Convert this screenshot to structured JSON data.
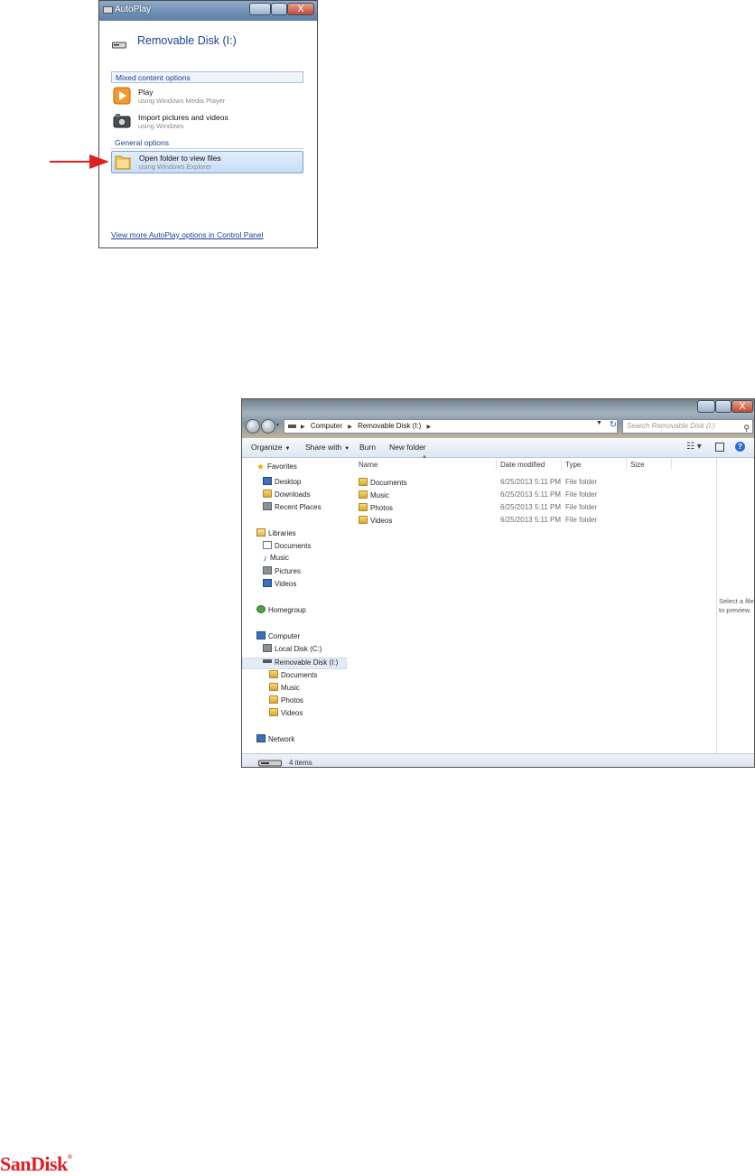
{
  "autoplay": {
    "window_title": "AutoPlay",
    "drive_title": "Removable Disk (I:)",
    "section_mixed": "Mixed content options",
    "section_general": "General options",
    "options": [
      {
        "main": "Play",
        "sub": "using Windows Media Player"
      },
      {
        "main": "Import pictures and videos",
        "sub": "using Windows"
      },
      {
        "main": "Open folder to view files",
        "sub": "using Windows Explorer"
      }
    ],
    "more_link": "View more AutoPlay options in Control Panel",
    "close_glyph": "X"
  },
  "explorer": {
    "breadcrumbs": [
      "Computer",
      "Removable Disk (I:)"
    ],
    "search_placeholder": "Search Removable Disk (I:)",
    "toolbar": {
      "organize": "Organize",
      "share_with": "Share with",
      "burn": "Burn",
      "new_folder": "New folder"
    },
    "nav": {
      "favorites": "Favorites",
      "desktop": "Desktop",
      "downloads": "Downloads",
      "recent_places": "Recent Places",
      "libraries": "Libraries",
      "lib_documents": "Documents",
      "lib_music": "Music",
      "lib_pictures": "Pictures",
      "lib_videos": "Videos",
      "homegroup": "Homegroup",
      "computer": "Computer",
      "local_disk": "Local Disk (C:)",
      "removable_disk": "Removable Disk (I:)",
      "disk_documents": "Documents",
      "disk_music": "Music",
      "disk_photos": "Photos",
      "disk_videos": "Videos",
      "network": "Network"
    },
    "columns": {
      "name": "Name",
      "date": "Date modified",
      "type": "Type",
      "size": "Size"
    },
    "files": [
      {
        "name": "Documents",
        "date": "6/25/2013 5:11 PM",
        "type": "File folder"
      },
      {
        "name": "Music",
        "date": "6/25/2013 5:11 PM",
        "type": "File folder"
      },
      {
        "name": "Photos",
        "date": "6/25/2013 5:11 PM",
        "type": "File folder"
      },
      {
        "name": "Videos",
        "date": "6/25/2013 5:11 PM",
        "type": "File folder"
      }
    ],
    "preview_text": "Select a file to preview.",
    "status": "4 items"
  },
  "brand": {
    "logo_text": "SanDisk",
    "logo_mark": "®",
    "accent": "#e31b23"
  }
}
